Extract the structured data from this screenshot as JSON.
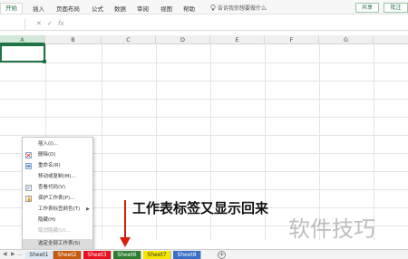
{
  "ribbon": {
    "tabs": [
      "开始",
      "插入",
      "页面布局",
      "公式",
      "数据",
      "审阅",
      "视图",
      "帮助"
    ],
    "search_text": "告诉我你想要做什么",
    "share_label": "共享",
    "comment_label": "批注"
  },
  "formula_bar": {
    "name_box": "",
    "cancel_symbol": "✕",
    "enter_symbol": "✓",
    "fx_symbol": "fx"
  },
  "columns": [
    "A",
    "B",
    "C",
    "D",
    "E",
    "F",
    "G"
  ],
  "context_menu": {
    "items": [
      {
        "label": "插入(I)...",
        "icon": "",
        "disabled": false
      },
      {
        "label": "删除(D)",
        "icon": "delete-sheet-icon",
        "disabled": false
      },
      {
        "label": "重命名(R)",
        "icon": "rename-icon",
        "disabled": false
      },
      {
        "label": "移动或复制(M)...",
        "icon": "",
        "disabled": false
      },
      {
        "label": "查看代码(V)",
        "icon": "view-code-icon",
        "disabled": false
      },
      {
        "label": "保护工作表(P)...",
        "icon": "protect-sheet-icon",
        "disabled": false
      },
      {
        "label": "工作表标签颜色(T)",
        "icon": "",
        "disabled": false,
        "submenu": true
      },
      {
        "label": "隐藏(H)",
        "icon": "",
        "disabled": false
      },
      {
        "label": "取消隐藏(U)...",
        "icon": "",
        "disabled": true
      },
      {
        "label": "选定全部工作表(S)",
        "icon": "",
        "disabled": false,
        "highlighted": true
      }
    ]
  },
  "annotation": "工作表标签又显示回来",
  "watermark": "软件技巧",
  "sheet_nav": {
    "prev": "◀",
    "next": "▶",
    "more": "..."
  },
  "sheets": [
    {
      "label": "Sheet1",
      "bg": "#dce8f4",
      "color": "#333333"
    },
    {
      "label": "Sheet2",
      "bg": "#c55a11",
      "color": "#ffffff"
    },
    {
      "label": "Sheet3",
      "bg": "#e81123",
      "color": "#ffffff"
    },
    {
      "label": "Sheet6",
      "bg": "#2e7d32",
      "color": "#ffffff"
    },
    {
      "label": "Sheet7",
      "bg": "#f5e600",
      "color": "#333333"
    },
    {
      "label": "Sheet8",
      "bg": "#3a6fc7",
      "color": "#ffffff"
    }
  ],
  "add_sheet_symbol": "+",
  "colors": {
    "accent": "#217346",
    "arrow": "#d81e06"
  }
}
